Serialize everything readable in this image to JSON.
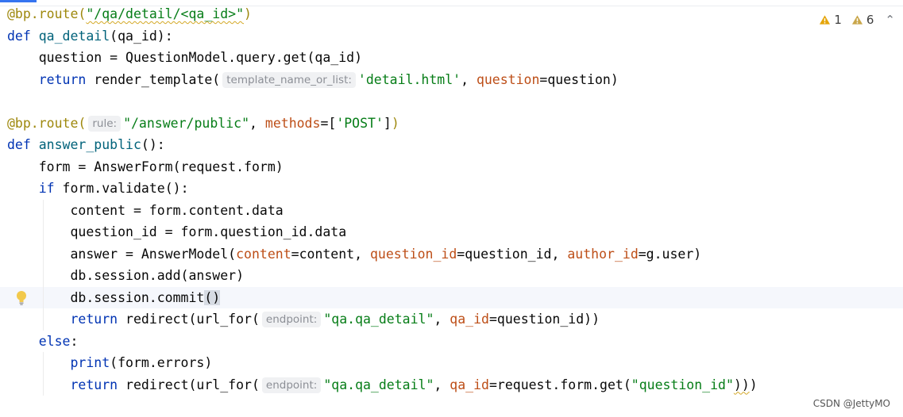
{
  "editor": {
    "lines": [
      [
        {
          "c": "dec",
          "t": "@bp.route("
        },
        {
          "c": "str wavy",
          "t": "\"/qa/detail/<qa_id>\""
        },
        {
          "c": "dec",
          "t": ")"
        }
      ],
      [
        {
          "c": "kw",
          "t": "def "
        },
        {
          "c": "fn",
          "t": "qa_detail"
        },
        {
          "c": "plain",
          "t": "(qa_id):"
        }
      ],
      [
        {
          "c": "plain",
          "t": "    question = QuestionModel.query.get(qa_id)"
        }
      ],
      [
        {
          "c": "plain",
          "t": "    "
        },
        {
          "c": "kw",
          "t": "return"
        },
        {
          "c": "plain",
          "t": " render_template("
        },
        {
          "hint": "template_name_or_list:"
        },
        {
          "c": "str",
          "t": "'detail.html'"
        },
        {
          "c": "plain",
          "t": ", "
        },
        {
          "c": "param",
          "t": "question"
        },
        {
          "c": "plain",
          "t": "=question)"
        }
      ],
      [],
      [
        {
          "c": "dec",
          "t": "@bp.route("
        },
        {
          "hint": "rule:"
        },
        {
          "c": "str",
          "t": "\"/answer/public\""
        },
        {
          "c": "plain",
          "t": ", "
        },
        {
          "c": "param",
          "t": "methods"
        },
        {
          "c": "plain",
          "t": "=["
        },
        {
          "c": "str",
          "t": "'POST'"
        },
        {
          "c": "plain",
          "t": "]"
        },
        {
          "c": "dec",
          "t": ")"
        }
      ],
      [
        {
          "c": "kw",
          "t": "def "
        },
        {
          "c": "fn",
          "t": "answer_public"
        },
        {
          "c": "plain",
          "t": "():"
        }
      ],
      [
        {
          "c": "plain",
          "t": "    form = AnswerForm(request.form)"
        }
      ],
      [
        {
          "c": "plain",
          "t": "    "
        },
        {
          "c": "kw",
          "t": "if"
        },
        {
          "c": "plain",
          "t": " form.validate():"
        }
      ],
      [
        {
          "c": "plain",
          "t": "        content = form.content.data"
        }
      ],
      [
        {
          "c": "plain",
          "t": "        question_id = form.question_id.data"
        }
      ],
      [
        {
          "c": "plain",
          "t": "        answer = AnswerModel("
        },
        {
          "c": "param",
          "t": "content"
        },
        {
          "c": "plain",
          "t": "=content, "
        },
        {
          "c": "param",
          "t": "question_id"
        },
        {
          "c": "plain",
          "t": "=question_id, "
        },
        {
          "c": "param",
          "t": "author_id"
        },
        {
          "c": "plain",
          "t": "=g.user)"
        }
      ],
      [
        {
          "c": "plain",
          "t": "        db.session.add(answer)"
        }
      ],
      [
        {
          "c": "plain",
          "t": "        db.session.commit"
        },
        {
          "c": "plain brace-hl",
          "t": "()"
        }
      ],
      [
        {
          "c": "plain",
          "t": "        "
        },
        {
          "c": "kw",
          "t": "return"
        },
        {
          "c": "plain",
          "t": " redirect(url_for("
        },
        {
          "hint": "endpoint:"
        },
        {
          "c": "str",
          "t": "\"qa.qa_detail\""
        },
        {
          "c": "plain",
          "t": ", "
        },
        {
          "c": "param",
          "t": "qa_id"
        },
        {
          "c": "plain",
          "t": "=question_id))"
        }
      ],
      [
        {
          "c": "plain",
          "t": "    "
        },
        {
          "c": "kw",
          "t": "else"
        },
        {
          "c": "plain",
          "t": ":"
        }
      ],
      [
        {
          "c": "plain",
          "t": "        "
        },
        {
          "c": "kw",
          "t": "print"
        },
        {
          "c": "plain",
          "t": "(form.errors)"
        }
      ],
      [
        {
          "c": "plain",
          "t": "        "
        },
        {
          "c": "kw",
          "t": "return"
        },
        {
          "c": "plain",
          "t": " redirect(url_for("
        },
        {
          "hint": "endpoint:"
        },
        {
          "c": "str",
          "t": "\"qa.qa_detail\""
        },
        {
          "c": "plain",
          "t": ", "
        },
        {
          "c": "param",
          "t": "qa_id"
        },
        {
          "c": "plain",
          "t": "=request.form.get("
        },
        {
          "c": "str",
          "t": "\"question_id\""
        },
        {
          "c": "plain wavy",
          "t": "))"
        },
        {
          "c": "plain",
          "t": ")"
        }
      ]
    ],
    "current_line_index": 13,
    "bulb_line_index": 13
  },
  "inspections": {
    "warning_count": "1",
    "weak_warning_count": "6",
    "warning_icon": "warning-triangle-icon",
    "weak_warning_icon": "weak-warning-triangle-icon",
    "collapse_icon": "chevron-up-icon",
    "warning_color": "#e5a50a",
    "weak_warning_color": "#c9a64a"
  },
  "watermark": "CSDN @JettyMO"
}
